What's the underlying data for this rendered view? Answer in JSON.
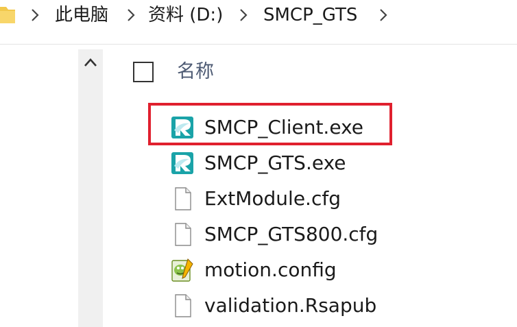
{
  "breadcrumb": {
    "items": [
      {
        "label": "此电脑"
      },
      {
        "label": "资料 (D:)"
      },
      {
        "label": "SMCP_GTS"
      }
    ]
  },
  "file_list": {
    "column_header": "名称",
    "files": [
      {
        "name": "SMCP_Client.exe",
        "icon": "app-exe-icon",
        "highlighted": true
      },
      {
        "name": "SMCP_GTS.exe",
        "icon": "app-exe-icon",
        "highlighted": false
      },
      {
        "name": "ExtModule.cfg",
        "icon": "blank-file-icon",
        "highlighted": false
      },
      {
        "name": "SMCP_GTS800.cfg",
        "icon": "blank-file-icon",
        "highlighted": false
      },
      {
        "name": "motion.config",
        "icon": "notepad-plus-plus-file-icon",
        "highlighted": false
      },
      {
        "name": "validation.Rsapub",
        "icon": "blank-file-icon",
        "highlighted": false
      }
    ]
  },
  "colors": {
    "highlight": "#e0202e",
    "header_text": "#4d5a73",
    "scroll_strip": "#f0f0f0",
    "exe_icon_teal": "#1aa3a8",
    "folder_yellow": "#f2c84b"
  }
}
